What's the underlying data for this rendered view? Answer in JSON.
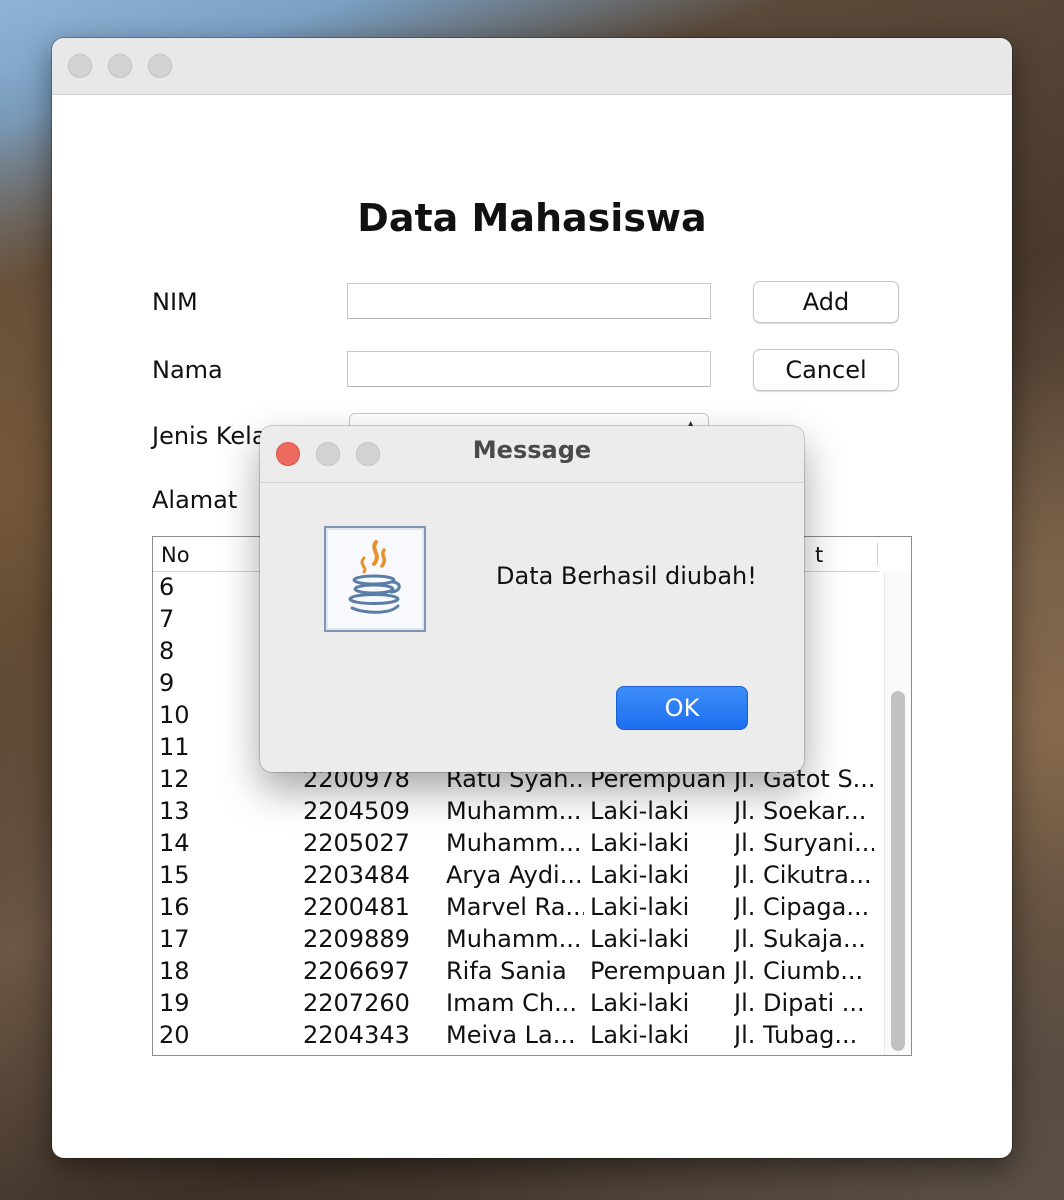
{
  "window": {
    "heading": "Data Mahasiswa"
  },
  "form": {
    "nim_label": "NIM",
    "nama_label": "Nama",
    "jenis_kelamin_label": "Jenis Kela",
    "alamat_label": "Alamat",
    "nim_value": "",
    "nama_value": ""
  },
  "buttons": {
    "add": "Add",
    "cancel": "Cancel"
  },
  "table": {
    "headers": [
      "No",
      "",
      "",
      "",
      "t"
    ],
    "rows": [
      {
        "no": "6",
        "nim": "",
        "nama": "",
        "jk": "",
        "alamat": "u N..."
      },
      {
        "no": "7",
        "nim": "",
        "nama": "",
        "jk": "",
        "alamat": "go ..."
      },
      {
        "no": "8",
        "nim": "",
        "nama": "",
        "jk": "",
        "alamat": "abu..."
      },
      {
        "no": "9",
        "nim": "",
        "nama": "",
        "jk": "",
        "alamat": "h B..."
      },
      {
        "no": "10",
        "nim": "",
        "nama": "",
        "jk": "",
        "alamat": "ir K..."
      },
      {
        "no": "11",
        "nim": "",
        "nama": "",
        "jk": "",
        "alamat": "ajar..."
      },
      {
        "no": "12",
        "nim": "2200978",
        "nama": "Ratu Syah...",
        "jk": "Perempuan",
        "alamat": "Jl. Gatot S..."
      },
      {
        "no": "13",
        "nim": "2204509",
        "nama": "Muhamm...",
        "jk": "Laki-laki",
        "alamat": "Jl. Soekar..."
      },
      {
        "no": "14",
        "nim": "2205027",
        "nama": "Muhamm...",
        "jk": "Laki-laki",
        "alamat": "Jl. Suryani..."
      },
      {
        "no": "15",
        "nim": "2203484",
        "nama": "Arya Aydi...",
        "jk": "Laki-laki",
        "alamat": "Jl. Cikutra..."
      },
      {
        "no": "16",
        "nim": "2200481",
        "nama": "Marvel Ra...",
        "jk": "Laki-laki",
        "alamat": "Jl. Cipaga..."
      },
      {
        "no": "17",
        "nim": "2209889",
        "nama": "Muhamm...",
        "jk": "Laki-laki",
        "alamat": "Jl. Sukaja..."
      },
      {
        "no": "18",
        "nim": "2206697",
        "nama": "Rifa Sania",
        "jk": "Perempuan",
        "alamat": "Jl. Ciumb..."
      },
      {
        "no": "19",
        "nim": "2207260",
        "nama": "Imam Ch...",
        "jk": "Laki-laki",
        "alamat": "Jl. Dipati ..."
      },
      {
        "no": "20",
        "nim": "2204343",
        "nama": "Meiva La...",
        "jk": "Laki-laki",
        "alamat": "Jl. Tubag..."
      }
    ]
  },
  "dialog": {
    "title": "Message",
    "message": "Data Berhasil diubah!",
    "ok_label": "OK",
    "icon": "java-cup-icon"
  },
  "colors": {
    "close_red": "#ed6a5e",
    "ok_blue": "#2a7ff4"
  }
}
